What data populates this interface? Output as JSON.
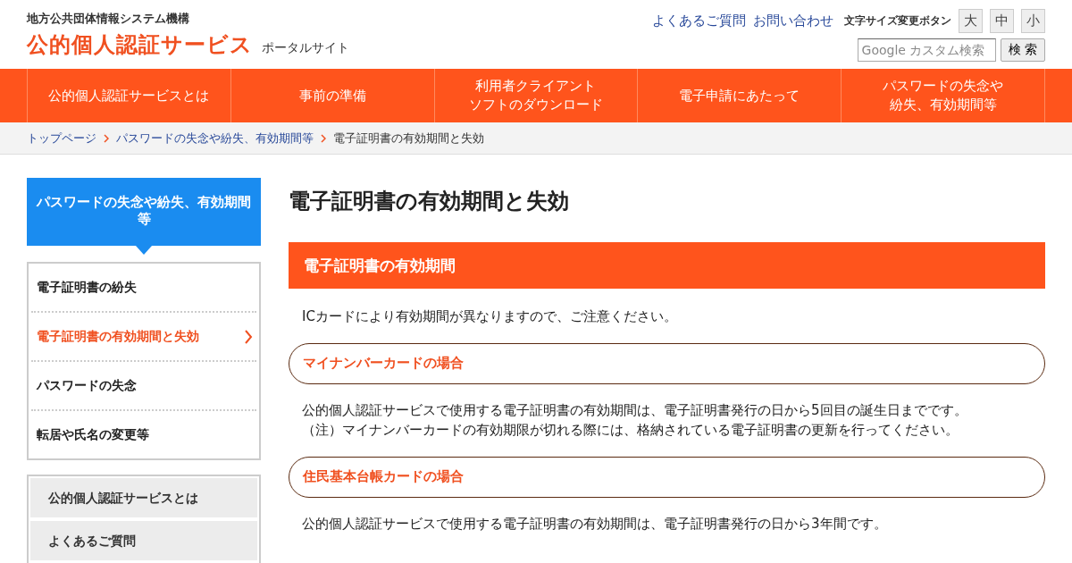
{
  "header": {
    "org": "地方公共団体情報システム機構",
    "site_title": "公的個人認証サービス",
    "site_subtitle": "ポータルサイト",
    "links": [
      "よくあるご質問",
      "お問い合わせ"
    ],
    "font_size_label": "文字サイズ変更ボタン",
    "font_size_buttons": [
      "大",
      "中",
      "小"
    ],
    "search": {
      "placeholder": "Google カスタム検索",
      "button": "検 索"
    }
  },
  "nav": [
    {
      "lines": [
        "公的個人認証サービスとは"
      ]
    },
    {
      "lines": [
        "事前の準備"
      ]
    },
    {
      "lines": [
        "利用者クライアント",
        "ソフトのダウンロード"
      ]
    },
    {
      "lines": [
        "電子申請にあたって"
      ]
    },
    {
      "lines": [
        "パスワードの失念や",
        "紛失、有効期間等"
      ]
    }
  ],
  "breadcrumb": [
    {
      "label": "トップページ",
      "link": true
    },
    {
      "label": "パスワードの失念や紛失、有効期間等",
      "link": true
    },
    {
      "label": "電子証明書の有効期間と失効",
      "link": false
    }
  ],
  "sidebar": {
    "heading": "パスワードの失念や紛失、有効期間等",
    "items": [
      {
        "label": "電子証明書の紛失",
        "selected": false
      },
      {
        "label": "電子証明書の有効期間と失効",
        "selected": true
      },
      {
        "label": "パスワードの失念",
        "selected": false
      },
      {
        "label": "転居や氏名の変更等",
        "selected": false
      }
    ],
    "menu": [
      "公的個人認証サービスとは",
      "よくあるご質問"
    ]
  },
  "main": {
    "title": "電子証明書の有効期間と失効",
    "section": {
      "heading": "電子証明書の有効期間",
      "intro": "ICカードにより有効期間が異なりますので、ご注意ください。",
      "subsections": [
        {
          "heading": "マイナンバーカードの場合",
          "paragraphs": [
            "公的個人認証サービスで使用する電子証明書の有効期間は、電子証明書発行の日から5回目の誕生日までです。",
            "（注）マイナンバーカードの有効期限が切れる際には、格納されている電子証明書の更新を行ってください。"
          ]
        },
        {
          "heading": "住民基本台帳カードの場合",
          "paragraphs": [
            "公的個人認証サービスで使用する電子証明書の有効期間は、電子証明書発行の日から3年間です。"
          ]
        }
      ]
    }
  }
}
